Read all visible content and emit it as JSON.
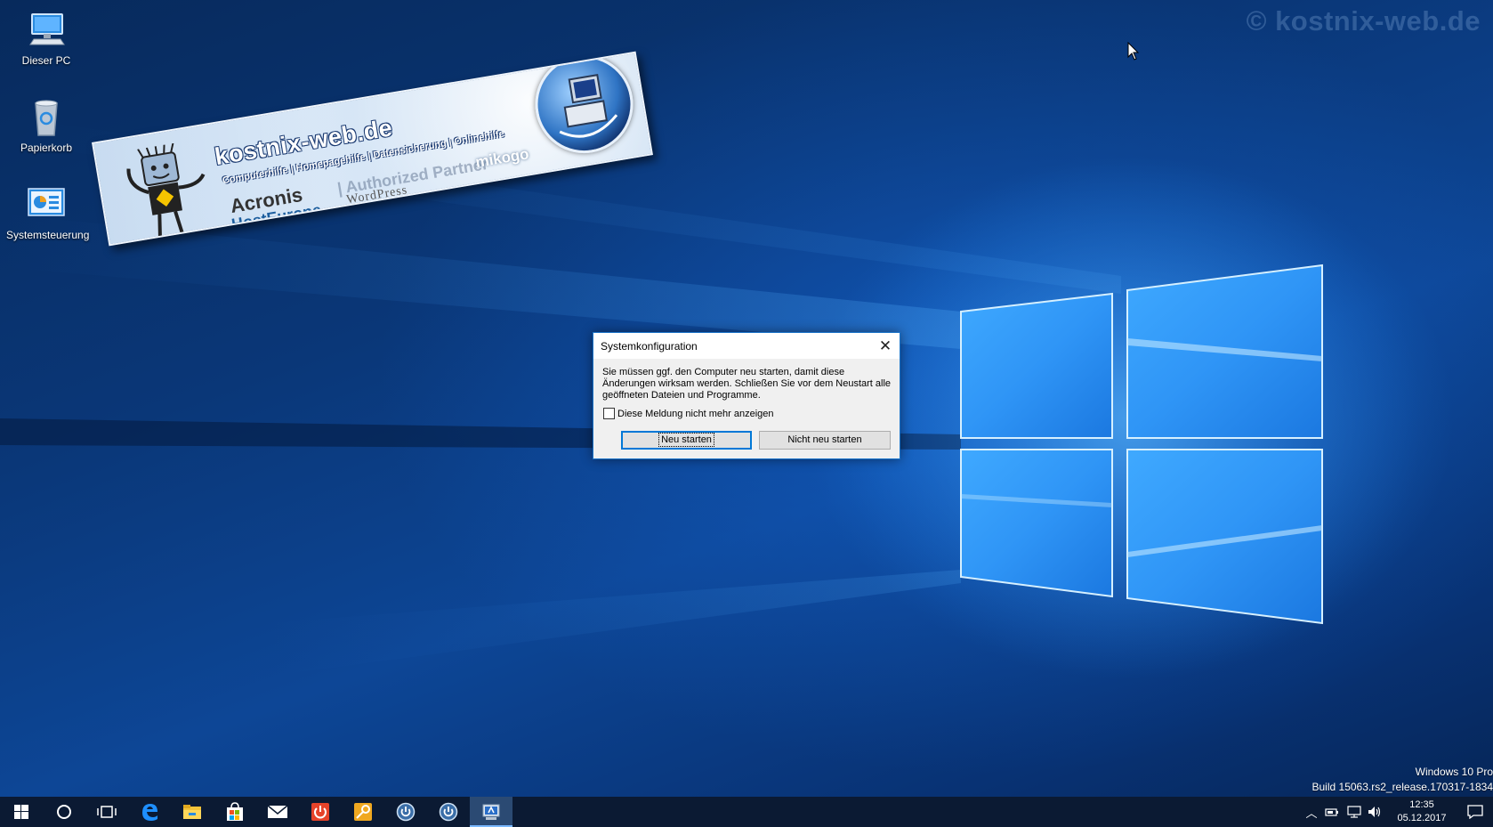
{
  "watermark": "© kostnix-web.de",
  "desktop": {
    "icons": [
      {
        "label": "Dieser PC",
        "icon": "this-pc-icon"
      },
      {
        "label": "Papierkorb",
        "icon": "recycle-bin-icon"
      },
      {
        "label": "Systemsteuerung",
        "icon": "control-panel-icon"
      }
    ]
  },
  "banner": {
    "title": "kostnix-web.de",
    "subtitle": "Computerhilfe | Homepagehilfe | Datensicherung | Onlinehilfe",
    "acronis": "Acronis",
    "partner": "| Authorized Partner",
    "hosteurope": "HostEurope",
    "wordpress": "WordPress",
    "mikogo": "mikogo"
  },
  "dialog": {
    "title": "Systemkonfiguration",
    "message": "Sie müssen ggf. den Computer neu starten, damit diese Änderungen wirksam werden. Schließen Sie vor dem Neustart alle geöffneten Dateien und Programme.",
    "checkbox_label": "Diese Meldung nicht mehr anzeigen",
    "checkbox_checked": false,
    "restart_button": "Neu starten",
    "no_restart_button": "Nicht neu starten"
  },
  "buildinfo": {
    "edition": "Windows 10 Pro",
    "build": "Build 15063.rs2_release.170317-1834"
  },
  "taskbar": {
    "apps": [
      "start-icon",
      "search-icon",
      "task-view-icon",
      "edge-icon",
      "file-explorer-icon",
      "store-icon",
      "mail-icon",
      "power-red-icon",
      "key-icon",
      "power-circle-icon",
      "power-circle-icon-2",
      "msconfig-icon"
    ],
    "clock_time": "12:35",
    "clock_date": "05.12.2017"
  },
  "colors": {
    "accent": "#0078d7",
    "taskbar": "#0b1a33",
    "dialog_bg": "#f0f0f0"
  }
}
